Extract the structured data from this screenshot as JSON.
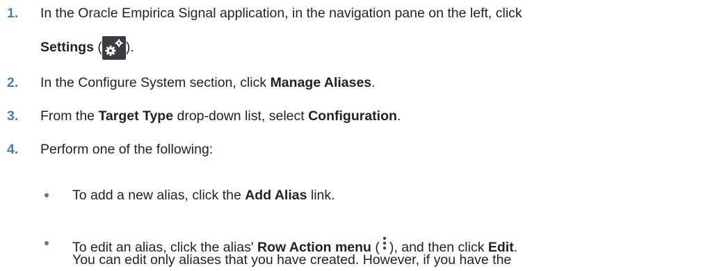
{
  "steps": [
    {
      "num": "1.",
      "line1": "In the Oracle Empirica Signal application, in the navigation pane on the left, click",
      "line2_bold": "Settings",
      "line2_open": " (",
      "line2_close": ")."
    },
    {
      "num": "2.",
      "pre": "In the Configure System section, click ",
      "bold": "Manage Aliases",
      "post": "."
    },
    {
      "num": "3.",
      "pre": "From the ",
      "bold1": "Target Type",
      "mid": " drop-down list, select ",
      "bold2": "Configuration",
      "post": "."
    },
    {
      "num": "4.",
      "text": "Perform one of the following:"
    }
  ],
  "bullets": [
    {
      "pre": "To add a new alias, click the ",
      "bold": "Add Alias",
      "post": " link."
    },
    {
      "pre": "To edit an alias, click the alias' ",
      "bold1": "Row Action menu",
      "mid1": " (",
      "mid2": "), and then click ",
      "bold2": "Edit",
      "post": ".",
      "line2": "You can edit only aliases that you have created. However, if you have the"
    }
  ],
  "icons": {
    "settings": "gear-icon",
    "row_action": "kebab-icon"
  },
  "colors": {
    "step_number": "#4a7db0",
    "bullet": "#4a7db0",
    "text": "#222222",
    "icon_bg": "#3a3d42"
  }
}
